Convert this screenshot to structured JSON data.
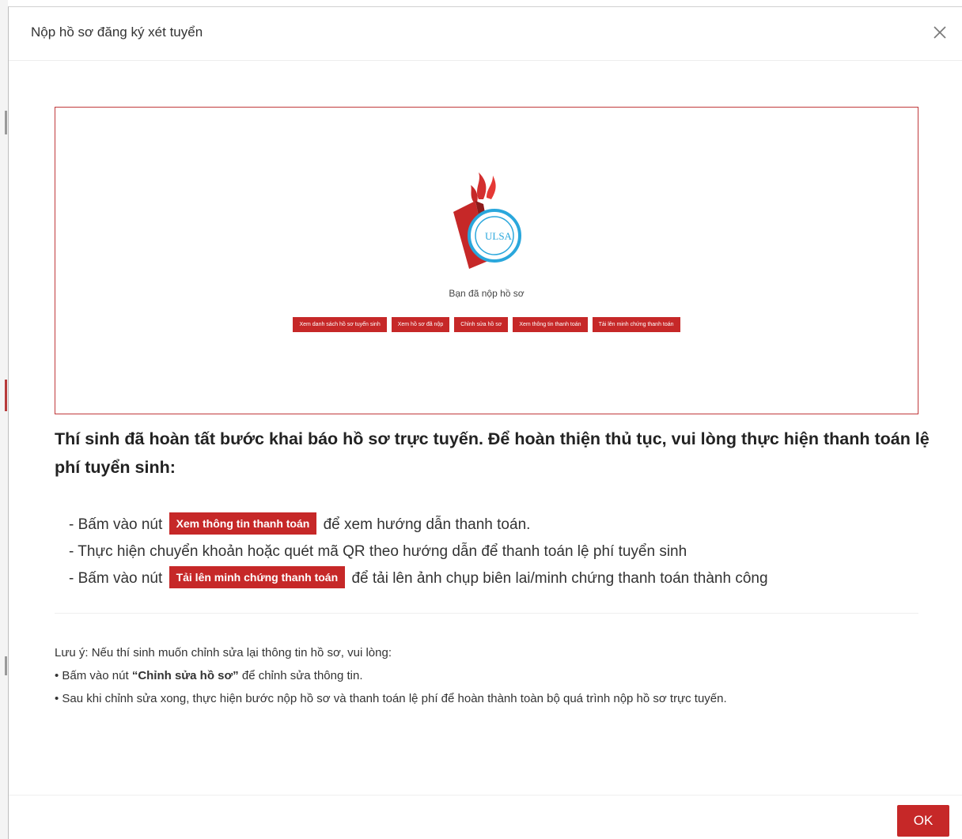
{
  "dialog": {
    "title": "Nộp hồ sơ đăng ký xét tuyển"
  },
  "preview": {
    "status_text": "Bạn đã nộp hồ sơ",
    "buttons": [
      "Xem danh sách hồ sơ tuyển sinh",
      "Xem hồ sơ đã nộp",
      "Chỉnh sửa hồ sơ",
      "Xem thông tin thanh toán",
      "Tải lên minh chứng thanh toán"
    ]
  },
  "heading": "Thí sinh đã hoàn tất bước khai báo hồ sơ trực tuyến. Để hoàn thiện thủ tục, vui lòng thực hiện thanh toán lệ phí tuyển sinh:",
  "instructions": {
    "line1_prefix": "- Bấm vào nút",
    "line1_button": "Xem thông tin thanh toán",
    "line1_suffix": "để xem hướng dẫn thanh toán.",
    "line2": "- Thực hiện chuyển khoản hoặc quét mã QR theo hướng dẫn để thanh toán lệ phí tuyển sinh",
    "line3_prefix": "- Bấm vào nút",
    "line3_button": "Tải lên minh chứng thanh toán",
    "line3_suffix": "để tải lên ảnh chụp biên lai/minh chứng thanh toán thành công"
  },
  "note": {
    "intro": "Lưu ý: Nếu thí sinh muốn chỉnh sửa lại thông tin hồ sơ, vui lòng:",
    "item1_prefix": "• Bấm vào nút",
    "item1_bold": "“Chỉnh sửa hồ sơ”",
    "item1_suffix": "để chỉnh sửa thông tin.",
    "item2": "• Sau khi chỉnh sửa xong, thực hiện bước nộp hồ sơ và thanh toán lệ phí để hoàn thành toàn bộ quá trình nộp hồ sơ trực tuyến."
  },
  "footer": {
    "ok_label": "OK"
  },
  "logo": {
    "text": "ULSA"
  },
  "colors": {
    "accent": "#c62828",
    "border_red": "#c0393b",
    "logo_blue": "#2aa7dc"
  },
  "icons": {
    "close": "close-icon",
    "logo": "ulsa-logo"
  }
}
